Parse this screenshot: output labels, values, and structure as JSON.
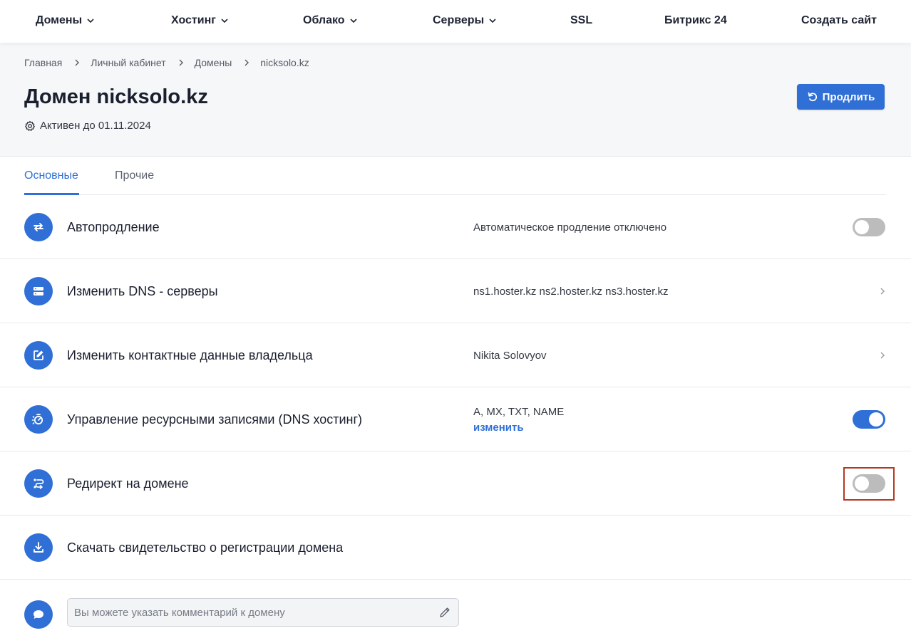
{
  "nav": {
    "items": [
      {
        "label": "Домены",
        "dropdown": true
      },
      {
        "label": "Хостинг",
        "dropdown": true
      },
      {
        "label": "Облако",
        "dropdown": true
      },
      {
        "label": "Серверы",
        "dropdown": true
      },
      {
        "label": "SSL",
        "dropdown": false
      },
      {
        "label": "Битрикс 24",
        "dropdown": false
      },
      {
        "label": "Создать сайт",
        "dropdown": false
      }
    ]
  },
  "breadcrumbs": [
    "Главная",
    "Личный кабинет",
    "Домены",
    "nicksolo.kz"
  ],
  "page": {
    "title": "Домен nicksolo.kz",
    "status": "Активен до 01.11.2024",
    "renew_button": "Продлить"
  },
  "tabs": [
    {
      "label": "Основные",
      "active": true
    },
    {
      "label": "Прочие",
      "active": false
    }
  ],
  "rows": [
    {
      "label": "Автопродление",
      "value": "Автоматическое продление отключено",
      "toggle": "off",
      "icon": "refresh-arrows-icon"
    },
    {
      "label": "Изменить DNS - серверы",
      "value": "ns1.hoster.kz ns2.hoster.kz ns3.hoster.kz",
      "chevron": true,
      "icon": "server-icon"
    },
    {
      "label": "Изменить контактные данные владельца",
      "value": "Nikita Solovyov",
      "chevron": true,
      "icon": "edit-icon"
    },
    {
      "label": "Управление ресурсными записями (DNS хостинг)",
      "value": "A, MX, TXT, NAME",
      "link": "изменить",
      "toggle": "on",
      "icon": "dns-hosting-icon"
    },
    {
      "label": "Редирект на домене",
      "toggle": "off",
      "icon": "redirect-icon"
    },
    {
      "label": "Скачать свидетельство о регистрации домена",
      "icon": "download-icon"
    }
  ],
  "comment": {
    "placeholder": "Вы можете указать комментарий к домену",
    "icon": "chat-bubble-icon"
  },
  "colors": {
    "accent": "#2f6fd6",
    "toggle_off": "#bcbcbc",
    "highlight": "#b5391f"
  }
}
